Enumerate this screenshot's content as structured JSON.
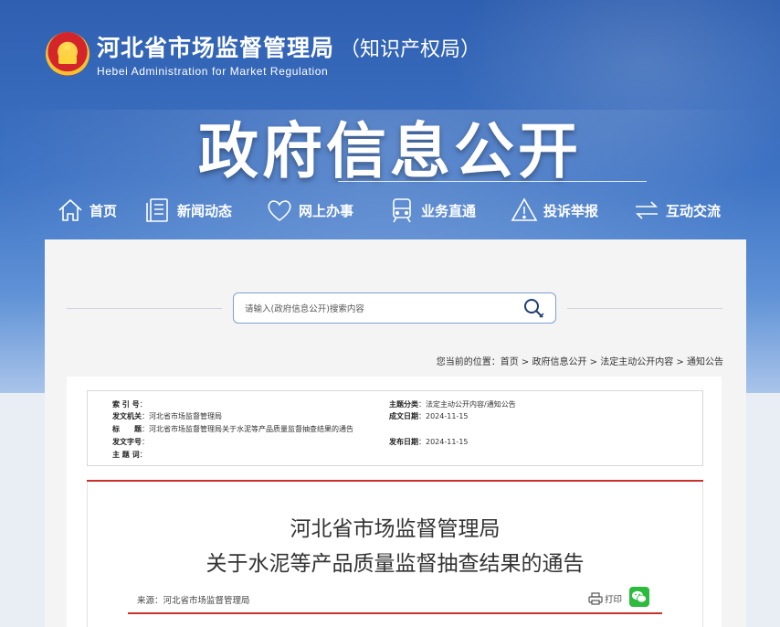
{
  "header": {
    "org_name": "河北省市场监督管理局",
    "org_sub": "（知识产权局）",
    "org_en": "Hebei Administration for Market Regulation",
    "page_title": "政府信息公开"
  },
  "nav": [
    {
      "label": "首页",
      "icon": "home-icon"
    },
    {
      "label": "新闻动态",
      "icon": "news-icon"
    },
    {
      "label": "网上办事",
      "icon": "heart-icon"
    },
    {
      "label": "业务直通",
      "icon": "train-icon"
    },
    {
      "label": "投诉举报",
      "icon": "warning-icon"
    },
    {
      "label": "互动交流",
      "icon": "exchange-icon"
    }
  ],
  "search": {
    "placeholder": "请输入(政府信息公开)搜索内容",
    "value": ""
  },
  "breadcrumb": {
    "prefix": "您当前的位置：",
    "items": [
      "首页",
      "政府信息公开",
      "法定主动公开内容",
      "通知公告"
    ],
    "separator": " > "
  },
  "meta": {
    "index_label": "索 引 号",
    "index_value": "",
    "issuer_label": "发文机关",
    "issuer_value": "河北省市场监督管理局",
    "title_label": "标　　题",
    "title_value": "河北省市场监督管理局关于水泥等产品质量监督抽查结果的通告",
    "docno_label": "发文字号",
    "docno_value": "",
    "topic_label": "主 题 词",
    "topic_value": "",
    "category_label": "主题分类",
    "category_value": "法定主动公开内容/通知公告",
    "created_label": "成文日期",
    "created_value": "2024-11-15",
    "published_label": "发布日期",
    "published_value": "2024-11-15"
  },
  "article": {
    "title_line1": "河北省市场监督管理局",
    "title_line2": "关于水泥等产品质量监督抽查结果的通告",
    "source": "来源：河北省市场监督管理局",
    "print_label": "打印"
  },
  "colors": {
    "accent_red": "#c9302c",
    "hero_blue": "#3e73c4",
    "wechat_green": "#2dbb3d"
  }
}
